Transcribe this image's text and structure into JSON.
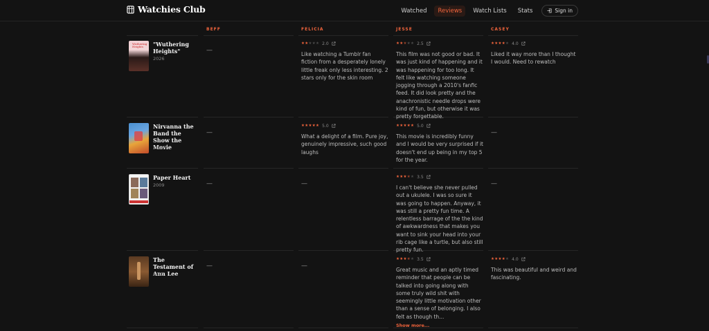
{
  "app": {
    "title": "Watchies Club",
    "icon": "film-reel-icon"
  },
  "nav": {
    "items": [
      {
        "label": "Watched",
        "active": false
      },
      {
        "label": "Reviews",
        "active": true
      },
      {
        "label": "Watch Lists",
        "active": false
      },
      {
        "label": "Stats",
        "active": false
      }
    ],
    "signin_label": "Sign in"
  },
  "colors": {
    "accent": "#f0643c",
    "background": "#131313"
  },
  "reviewers": [
    "BEFF",
    "FELICIA",
    "JESSE",
    "CASEY"
  ],
  "films": [
    {
      "title": "\"Wuthering Heights\"",
      "year": "2026",
      "reviews": {
        "BEFF": null,
        "FELICIA": {
          "rating": "2.0",
          "stars": 2,
          "text": "Like watching a Tumblr fan fiction from a desperately lonely little freak only less interesting. 2 stars only for the skin room"
        },
        "JESSE": {
          "rating": "2.5",
          "stars": 2.5,
          "text": "This film was not good or bad. It was just kind of happening and it was happening for too long. It felt like watching someone jogging through a 2010's fanfic feed. It did look pretty and the anachronistic needle drops were kind of fun, but otherwise it was pretty forgettable."
        },
        "CASEY": {
          "rating": "4.0",
          "stars": 4,
          "text": "Liked it way more than I thought I would. Need to rewatch"
        }
      }
    },
    {
      "title": "Nirvanna the Band the Show the Movie",
      "year": "2026",
      "reviews": {
        "BEFF": null,
        "FELICIA": {
          "rating": "5.0",
          "stars": 5,
          "text": "What a delight of a film. Pure joy, genuinely impressive, such good laughs"
        },
        "JESSE": {
          "rating": "5.0",
          "stars": 5,
          "text": "This movie is incredibly funny and I would be very surprised if it doesn't end up being in my top 5 for the year."
        },
        "CASEY": null
      }
    },
    {
      "title": "Paper Heart",
      "year": "2009",
      "reviews": {
        "BEFF": null,
        "FELICIA": null,
        "JESSE": {
          "rating": "3.5",
          "stars": 3.5,
          "text": "I can't believe she never pulled out a ukulele. I was so sure it was going to happen. Anyway, it was still a pretty fun time. A relentless barrage of the the kind of awkwardness that makes you want to sink your head into your rib cage like a turtle, but also still pretty fun."
        },
        "CASEY": null
      }
    },
    {
      "title": "The Testament of Ann Lee",
      "year": "2025",
      "reviews": {
        "BEFF": null,
        "FELICIA": null,
        "JESSE": {
          "rating": "3.5",
          "stars": 3.5,
          "text": "Great music and an aptly timed reminder that people can be talked into going along with some truly wild shit with seemingly little motivation other than a sense of belonging. I also felt as though th...",
          "more": "Show more..."
        },
        "CASEY": {
          "rating": "4.0",
          "stars": 4,
          "text": "This was beautiful and weird and fascinating."
        }
      }
    }
  ],
  "empty_marker": "—"
}
